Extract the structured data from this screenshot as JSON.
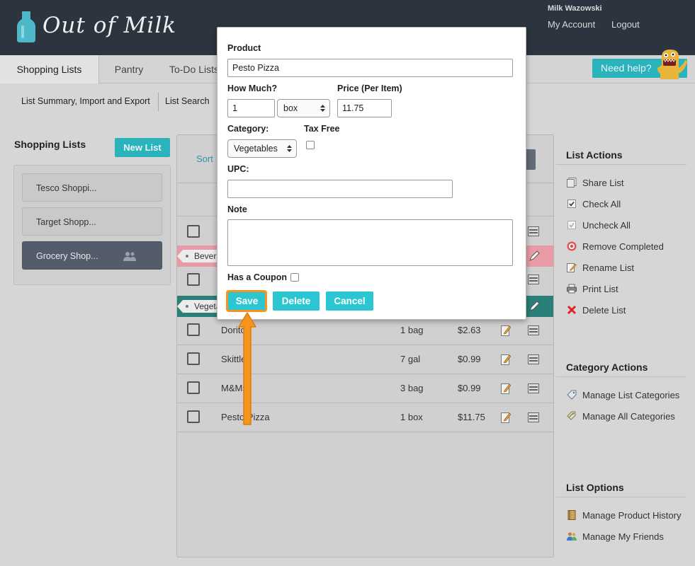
{
  "header": {
    "brand": "Out of Milk",
    "user_name": "Milk Wazowski",
    "my_account": "My Account",
    "logout": "Logout"
  },
  "tabs": [
    {
      "label": "Shopping Lists"
    },
    {
      "label": "Pantry"
    },
    {
      "label": "To-Do Lists"
    }
  ],
  "help_button": "Need help?",
  "subnav": [
    {
      "label": "List Summary, Import and Export"
    },
    {
      "label": "List Search"
    }
  ],
  "sidebar": {
    "title": "Shopping Lists",
    "new_list": "New List",
    "lists": [
      {
        "label": "Tesco Shoppi..."
      },
      {
        "label": "Target Shopp..."
      },
      {
        "label": "Grocery Shop..."
      }
    ]
  },
  "list": {
    "sort_label": "Sort",
    "categories": [
      {
        "name": "Beverages",
        "color": "#e89aa6"
      },
      {
        "name": "Vegetables",
        "color": "#2a7f78"
      }
    ],
    "items": [
      {
        "name": "Doritos",
        "qty": "1 bag",
        "price": "$2.63"
      },
      {
        "name": "Skittles",
        "qty": "7 gal",
        "price": "$0.99"
      },
      {
        "name": "M&Ms",
        "qty": "3 bag",
        "price": "$0.99"
      },
      {
        "name": "Pesto Pizza",
        "qty": "1 box",
        "price": "$11.75"
      }
    ]
  },
  "list_actions": {
    "title": "List Actions",
    "items": [
      {
        "label": "Share List",
        "icon": "share-icon"
      },
      {
        "label": "Check All",
        "icon": "check-all-icon"
      },
      {
        "label": "Uncheck All",
        "icon": "uncheck-all-icon"
      },
      {
        "label": "Remove Completed",
        "icon": "target-icon"
      },
      {
        "label": "Rename List",
        "icon": "rename-icon"
      },
      {
        "label": "Print List",
        "icon": "printer-icon"
      },
      {
        "label": "Delete List",
        "icon": "x-icon"
      }
    ]
  },
  "category_actions": {
    "title": "Category Actions",
    "items": [
      {
        "label": "Manage List Categories",
        "icon": "tag-icon"
      },
      {
        "label": "Manage All Categories",
        "icon": "tags-icon"
      }
    ]
  },
  "list_options": {
    "title": "List Options",
    "items": [
      {
        "label": "Manage Product History",
        "icon": "book-icon"
      },
      {
        "label": "Manage My Friends",
        "icon": "friends-icon"
      }
    ]
  },
  "modal": {
    "product_label": "Product",
    "product_value": "Pesto Pizza",
    "how_much_label": "How Much?",
    "quantity_value": "1",
    "unit_value": "box",
    "price_label": "Price (Per Item)",
    "price_value": "11.75",
    "category_label": "Category:",
    "category_value": "Vegetables",
    "tax_free_label": "Tax Free",
    "upc_label": "UPC:",
    "upc_value": "",
    "note_label": "Note",
    "note_value": "",
    "coupon_label": "Has a Coupon",
    "save": "Save",
    "delete": "Delete",
    "cancel": "Cancel"
  },
  "colors": {
    "accent": "#2ab3bb",
    "header_bg": "#2c3440",
    "highlight": "#f5951e"
  }
}
